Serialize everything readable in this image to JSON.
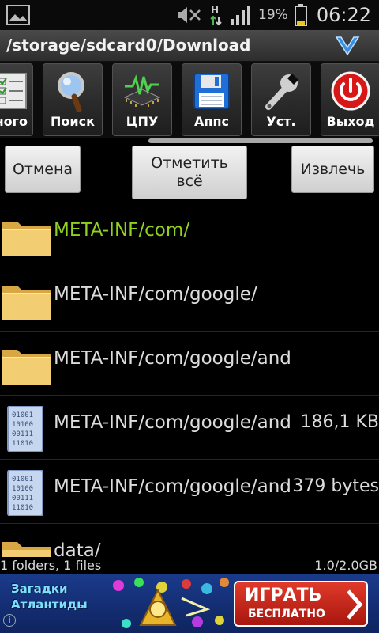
{
  "status_bar": {
    "battery_pct": "19%",
    "time": "06:22",
    "icons": [
      "image-icon",
      "mute-icon",
      "h-network-icon",
      "signal-icon",
      "battery-icon"
    ]
  },
  "header": {
    "path": "/storage/sdcard0/Download",
    "menu_icon": "chevron-down-icon"
  },
  "toolbar": {
    "items": [
      {
        "label": "ного",
        "icon": "checklist-icon"
      },
      {
        "label": "Поиск",
        "icon": "magnifier-icon"
      },
      {
        "label": "ЦПУ",
        "icon": "cpu-icon"
      },
      {
        "label": "Аппс",
        "icon": "floppy-disk-icon"
      },
      {
        "label": "Уст.",
        "icon": "wrench-icon"
      },
      {
        "label": "Выход",
        "icon": "power-icon"
      }
    ]
  },
  "actions": {
    "cancel": "Отмена",
    "select_all_line1": "Отметить",
    "select_all_line2": "всё",
    "extract": "Извлечь"
  },
  "files": [
    {
      "name": "META-INF/com/",
      "size": "",
      "type": "folder",
      "selected": true
    },
    {
      "name": "META-INF/com/google/",
      "size": "",
      "type": "folder",
      "selected": false
    },
    {
      "name": "META-INF/com/google/and",
      "size": "",
      "type": "folder",
      "selected": false
    },
    {
      "name": "META-INF/com/google/and",
      "size": "186,1 KB",
      "type": "binary",
      "selected": false
    },
    {
      "name": "META-INF/com/google/and",
      "size": "379 bytes",
      "type": "binary",
      "selected": false
    },
    {
      "name": "data/",
      "size": "",
      "type": "folder",
      "selected": false
    }
  ],
  "summary": {
    "counts": "1 folders, 1 files",
    "storage": "1.0/2.0GB"
  },
  "ad": {
    "title": "Загадки Атлантиды",
    "cta_line1": "ИГРАТЬ",
    "cta_line2": "БЕСПЛАТНО",
    "info_icon": "info-icon",
    "colors": {
      "accent": "#8fd11e",
      "cta": "#d3281b",
      "banner": "#173478"
    }
  }
}
